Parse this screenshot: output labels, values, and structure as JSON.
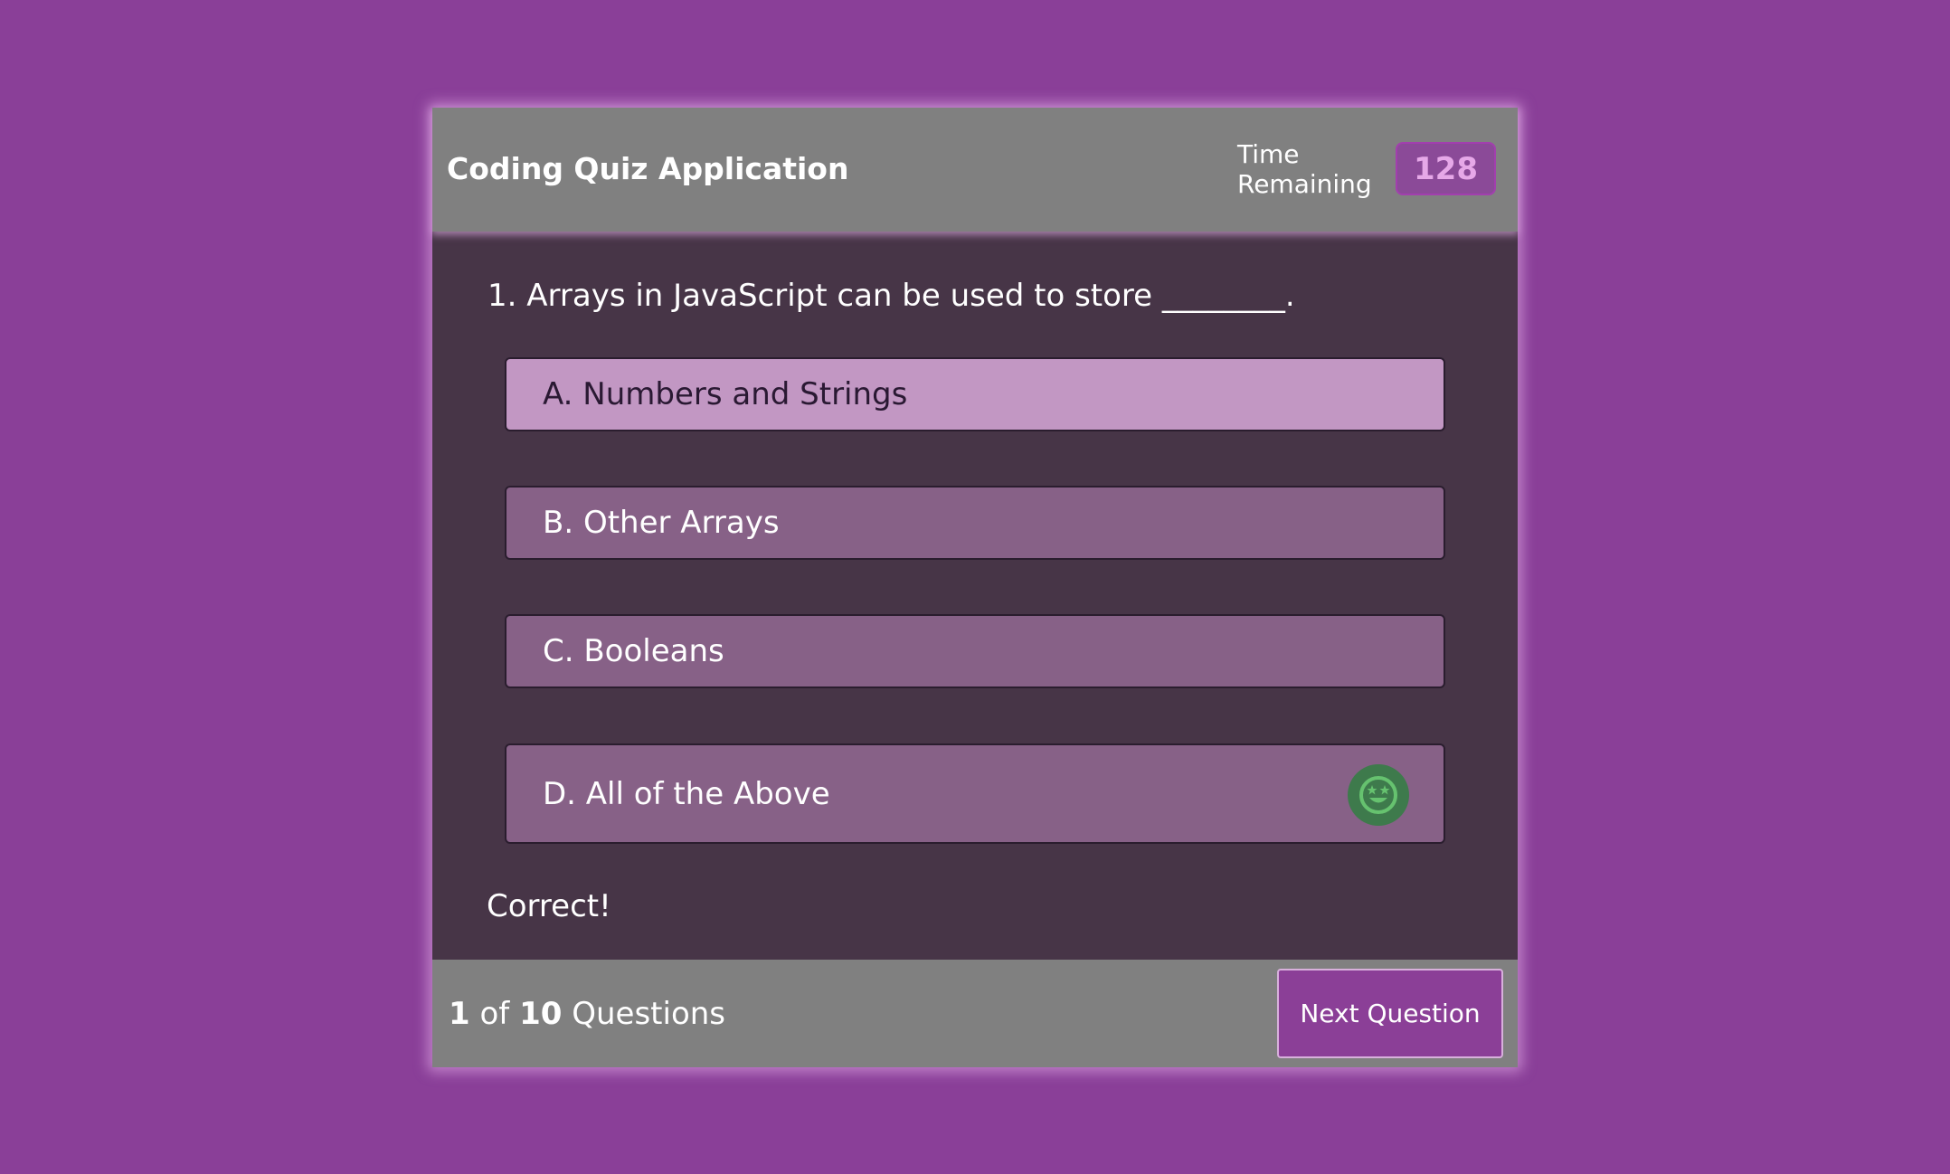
{
  "header": {
    "title": "Coding Quiz Application",
    "timer_label": "Time Remaining",
    "timer_value": "128"
  },
  "question": {
    "text": "1. Arrays in JavaScript can be used to store ________."
  },
  "options": [
    {
      "label": "A. Numbers and Strings",
      "state": "selected"
    },
    {
      "label": "B. Other Arrays",
      "state": "default"
    },
    {
      "label": "C. Booleans",
      "state": "default"
    },
    {
      "label": "D. All of the Above",
      "state": "correct",
      "icon": "star-eyes-smiley-icon"
    }
  ],
  "feedback": "Correct!",
  "footer": {
    "current": "1",
    "of": "of",
    "total": "10",
    "suffix": "Questions",
    "next_label": "Next Question"
  },
  "colors": {
    "background": "#8a3f98",
    "panel": "#473547",
    "bar": "#808080",
    "selected_option": "#c297c3",
    "option": "#876187",
    "correct_icon": "#3e7a4c"
  }
}
